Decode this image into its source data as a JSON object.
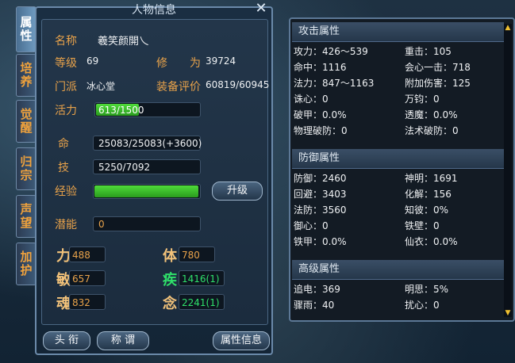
{
  "window": {
    "title": "人物信息"
  },
  "tabs": [
    {
      "label": "属性",
      "active": true
    },
    {
      "label": "培养",
      "active": false
    },
    {
      "label": "觉醒",
      "active": false
    },
    {
      "label": "归宗",
      "active": false
    },
    {
      "label": "声望",
      "active": false
    },
    {
      "label": "加护",
      "active": false
    }
  ],
  "profile": {
    "name_label": "名称",
    "name": "羲笑颜開乀",
    "level_label": "等级",
    "level": "69",
    "cultivation_label": "修　　为",
    "cultivation": "39724",
    "sect_label": "门派",
    "sect": "冰心堂",
    "equip_label": "装备评价",
    "equip": "60819/60945"
  },
  "vitals": {
    "energy_label": "活力",
    "energy": "613/1500",
    "energy_fraction": 0.41,
    "life_label": "命",
    "life": "25083/25083(+3600)",
    "skill_label": "技",
    "skill": "5250/7092",
    "exp_label": "经验",
    "exp_fraction": 0.98,
    "upgrade_label": "升级",
    "potential_label": "潜能",
    "potential": "0"
  },
  "attributes": {
    "str_label": "力",
    "str": "488",
    "con_label": "体",
    "con": "780",
    "agi_label": "敏",
    "agi": "657",
    "spd_label": "疾",
    "spd": "1416(1)",
    "soul_label": "魂",
    "soul": "832",
    "mind_label": "念",
    "mind": "2241(1)"
  },
  "footer": {
    "title_btn": "头 衔",
    "appellation_btn": "称 谓",
    "info_btn": "属性信息"
  },
  "attack": {
    "header": "攻击属性",
    "rows": [
      [
        "攻力：426～539",
        "重击：105"
      ],
      [
        "命中：1116",
        "会心一击：718"
      ],
      [
        "法力：847～1163",
        "附加伤害：125"
      ],
      [
        "诛心：0",
        "万钧：0"
      ],
      [
        "破甲：0.0%",
        "透魔：0.0%"
      ],
      [
        "物理破防：0",
        "法术破防：0"
      ]
    ]
  },
  "defense": {
    "header": "防御属性",
    "rows": [
      [
        "防御：2460",
        "神明：1691"
      ],
      [
        "回避：3403",
        "化解：156"
      ],
      [
        "法防：3560",
        "知彼：0%"
      ],
      [
        "御心：0",
        "铁壁：0"
      ],
      [
        "铁甲：0.0%",
        "仙衣：0.0%"
      ]
    ]
  },
  "advanced": {
    "header": "高级属性",
    "rows": [
      [
        "追电：369",
        "明思：5%"
      ],
      [
        "骤雨：40",
        "扰心：0"
      ]
    ]
  }
}
